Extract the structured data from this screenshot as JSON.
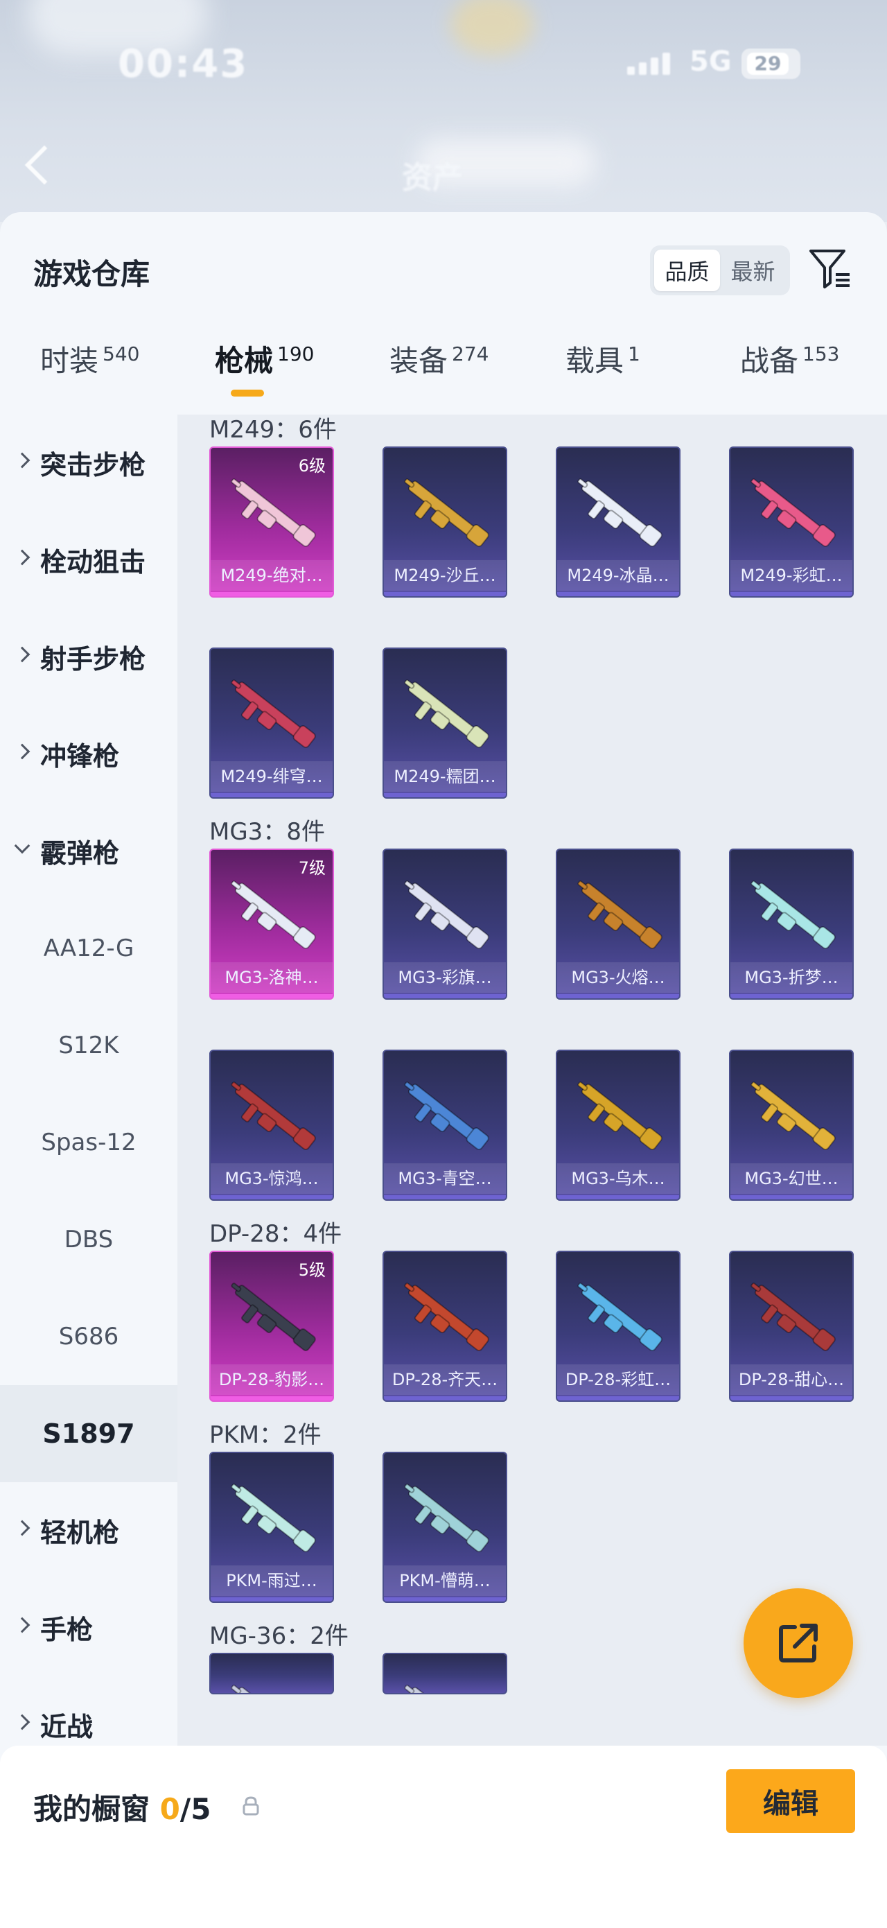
{
  "status_bar": {
    "time": "00:43",
    "network": "5G",
    "battery": "29",
    "carrier_left": "时装",
    "carrier_right": "战备",
    "assets_label": "资产"
  },
  "sheet": {
    "title": "游戏仓库",
    "sort_options": [
      "品质",
      "最新"
    ],
    "sort_selected": "品质"
  },
  "tabs": [
    {
      "label": "时装",
      "count": "540"
    },
    {
      "label": "枪械",
      "count": "190"
    },
    {
      "label": "装备",
      "count": "274"
    },
    {
      "label": "载具",
      "count": "1"
    },
    {
      "label": "战备",
      "count": "153"
    }
  ],
  "sidebar": {
    "categories": [
      {
        "label": "突击步枪",
        "expanded": false
      },
      {
        "label": "栓动狙击",
        "expanded": false
      },
      {
        "label": "射手步枪",
        "expanded": false
      },
      {
        "label": "冲锋枪",
        "expanded": false
      },
      {
        "label": "霰弹枪",
        "expanded": true
      },
      {
        "label": "轻机枪",
        "expanded": false
      },
      {
        "label": "手枪",
        "expanded": false
      },
      {
        "label": "近战",
        "expanded": false
      }
    ],
    "shotgun_subs": [
      "AA12-G",
      "S12K",
      "Spas-12",
      "DBS",
      "S686",
      "S1897"
    ],
    "selected_sub": "S1897"
  },
  "sections": [
    {
      "title": "M249：6件",
      "items": [
        {
          "name": "M249-绝对…",
          "level": "6级",
          "rarity": "pink",
          "color": "#f0c6d8"
        },
        {
          "name": "M249-沙丘…",
          "level": "",
          "rarity": "purple",
          "color": "#d7a53a"
        },
        {
          "name": "M249-冰晶…",
          "level": "",
          "rarity": "purple",
          "color": "#e9eef8"
        },
        {
          "name": "M249-彩虹…",
          "level": "",
          "rarity": "purple",
          "color": "#e85a8a"
        },
        {
          "name": "M249-绯穹…",
          "level": "",
          "rarity": "purple",
          "color": "#c9415c"
        },
        {
          "name": "M249-糯团…",
          "level": "",
          "rarity": "purple",
          "color": "#d9e4b8"
        }
      ]
    },
    {
      "title": "MG3：8件",
      "items": [
        {
          "name": "MG3-洛神…",
          "level": "7级",
          "rarity": "pink",
          "color": "#e6ebf5"
        },
        {
          "name": "MG3-彩旗…",
          "level": "",
          "rarity": "purple",
          "color": "#dfe2f2"
        },
        {
          "name": "MG3-火熔…",
          "level": "",
          "rarity": "purple",
          "color": "#c7822c"
        },
        {
          "name": "MG3-折梦…",
          "level": "",
          "rarity": "purple",
          "color": "#a9e6e6"
        },
        {
          "name": "MG3-惊鸿…",
          "level": "",
          "rarity": "purple",
          "color": "#b23a3a"
        },
        {
          "name": "MG3-青空…",
          "level": "",
          "rarity": "purple",
          "color": "#4c86d6"
        },
        {
          "name": "MG3-乌木…",
          "level": "",
          "rarity": "purple",
          "color": "#d6a428"
        },
        {
          "name": "MG3-幻世…",
          "level": "",
          "rarity": "purple",
          "color": "#e2b23a"
        }
      ]
    },
    {
      "title": "DP-28：4件",
      "items": [
        {
          "name": "DP-28-豹影…",
          "level": "5级",
          "rarity": "pink",
          "color": "#3a3f4e"
        },
        {
          "name": "DP-28-齐天…",
          "level": "",
          "rarity": "purple",
          "color": "#c3482e"
        },
        {
          "name": "DP-28-彩虹…",
          "level": "",
          "rarity": "purple",
          "color": "#5ab5e9"
        },
        {
          "name": "DP-28-甜心…",
          "level": "",
          "rarity": "purple",
          "color": "#a93a3a"
        }
      ]
    },
    {
      "title": "PKM：2件",
      "items": [
        {
          "name": "PKM-雨过…",
          "level": "",
          "rarity": "purple",
          "color": "#bfeae4"
        },
        {
          "name": "PKM-懵萌…",
          "level": "",
          "rarity": "purple",
          "color": "#9fd2d8"
        }
      ]
    },
    {
      "title": "MG-36：2件",
      "items": [
        {
          "name": "",
          "level": "",
          "rarity": "purple",
          "color": "#c8cde0"
        },
        {
          "name": "",
          "level": "",
          "rarity": "purple",
          "color": "#c8cde0"
        }
      ]
    }
  ],
  "showcase": {
    "label": "我的橱窗",
    "count": "0",
    "total": "/5",
    "edit_label": "编辑"
  },
  "icons": {
    "filter": "filter-icon",
    "share": "share-icon",
    "lock": "lock-icon",
    "back": "back-icon"
  },
  "colors": {
    "accent": "#f6a91a",
    "rare_pink": "#d23fc6",
    "rare_purple": "#5950a8"
  }
}
